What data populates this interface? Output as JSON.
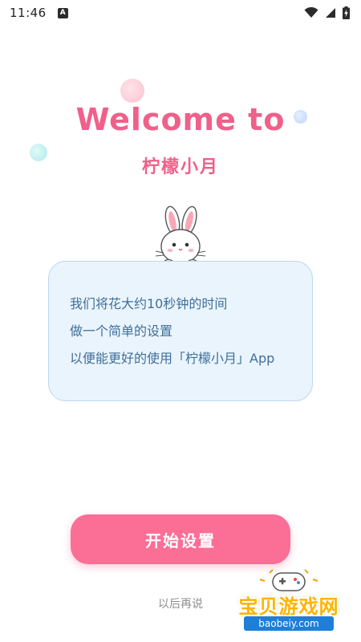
{
  "status_bar": {
    "time": "11:46",
    "notification_icon": "a-badge-icon",
    "wifi_icon": "wifi-icon",
    "signal_icon": "signal-icon",
    "battery_icon": "battery-charging-icon"
  },
  "welcome": {
    "title": "Welcome to",
    "app_name": "柠檬小月"
  },
  "info_card": {
    "lines": [
      "我们将花大约10秒钟的时间",
      "做一个简单的设置",
      "以便能更好的使用「柠檬小月」App"
    ]
  },
  "actions": {
    "start_label": "开始设置",
    "later_label": "以后再说"
  },
  "watermark": {
    "text": "宝贝游戏网",
    "url": "baobeiy.com"
  },
  "colors": {
    "accent_pink": "#f0608a",
    "button_pink": "#fb6e96",
    "card_bg": "#eaf4fc",
    "card_text": "#3f6f9a"
  }
}
